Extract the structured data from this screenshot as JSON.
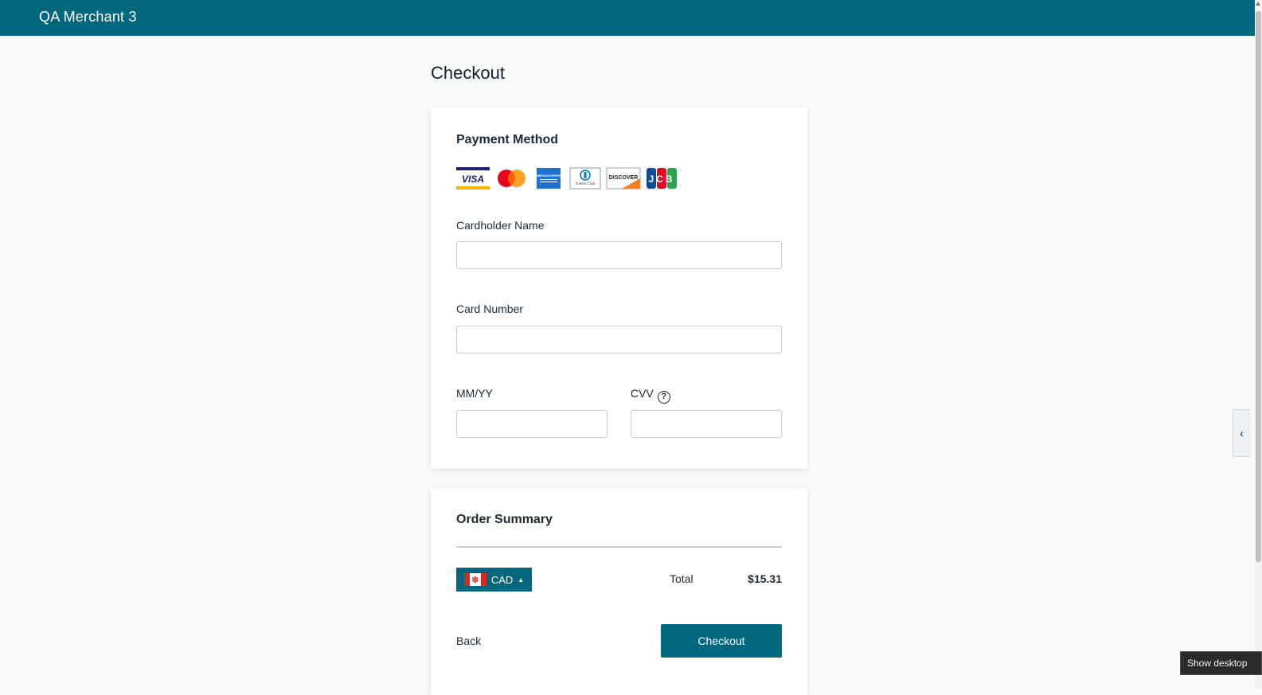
{
  "header": {
    "merchant_name": "QA Merchant 3"
  },
  "page": {
    "title": "Checkout"
  },
  "payment": {
    "section_title": "Payment Method",
    "brands": [
      "visa-icon",
      "mastercard-icon",
      "amex-icon",
      "diners-club-icon",
      "discover-icon",
      "jcb-icon"
    ],
    "brand_text": {
      "visa": "VISA",
      "amex": "AMERICAN EXPRESS",
      "diners": "Diners Club",
      "discover": "DISCOVER",
      "jcb": "JCB"
    },
    "cardholder_label": "Cardholder Name",
    "cardholder_value": "",
    "card_number_label": "Card Number",
    "card_number_value": "",
    "expiry_label": "MM/YY",
    "expiry_value": "",
    "cvv_label": "CVV",
    "cvv_help": "?",
    "cvv_value": ""
  },
  "summary": {
    "section_title": "Order Summary",
    "currency": "CAD",
    "total_label": "Total",
    "total_value": "$15.31",
    "back_label": "Back",
    "checkout_label": "Checkout"
  },
  "overlay": {
    "side_tab_glyph": "‹",
    "show_desktop_tip": "Show desktop"
  },
  "colors": {
    "brand": "#03677e",
    "background": "#f8f9f9",
    "card": "#ffffff"
  }
}
